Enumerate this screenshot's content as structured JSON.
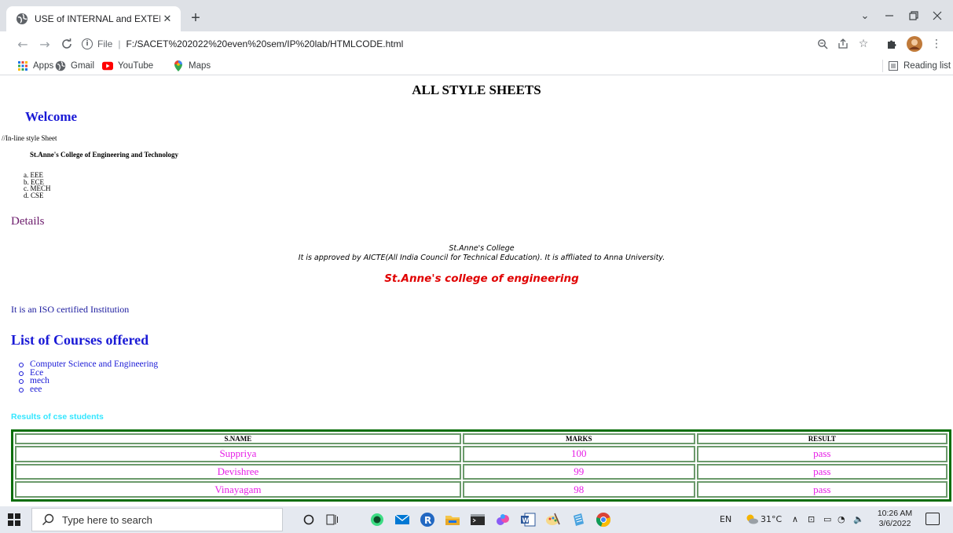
{
  "browser": {
    "tab_title": "USE of INTERNAL and EXTERNAL",
    "tab_close": "✕",
    "new_tab": "+",
    "omnibox_file_label": "File",
    "omnibox_separator": "|",
    "url": "F:/SACET%202022%20even%20sem/IP%20lab/HTMLCODE.html",
    "bookmarks": [
      {
        "label": "Apps",
        "icon": "apps-grid-icon"
      },
      {
        "label": "Gmail",
        "icon": "globe-icon"
      },
      {
        "label": "YouTube",
        "icon": "youtube-icon"
      },
      {
        "label": "Maps",
        "icon": "maps-pin-icon"
      }
    ],
    "reading_list": "Reading list"
  },
  "page": {
    "heading": "ALL STYLE SHEETS",
    "welcome": "Welcome",
    "inline_note": "//In-line style Sheet",
    "college_small": "St.Anne's College of Engineering and Technology",
    "ordered_list": [
      "a. EEE",
      "b. ECE",
      "c. MECH",
      "d. CSE"
    ],
    "details": "Details",
    "address_line1": "St.Anne's College",
    "address_line2": "It is approved by AICTE(All India Council for Technical Education). It is affliated to Anna University.",
    "college_red": "St.Anne's college of engineering",
    "iso_line": "It is an ISO certified Institution",
    "courses_title": "List of Courses offered",
    "courses": [
      "Computer Science and Engineering",
      "Ece",
      "mech",
      "eee"
    ],
    "results_title": "Results of cse students",
    "table": {
      "headers": [
        "S.NAME",
        "MARKS",
        "RESULT"
      ],
      "rows": [
        [
          "Suppriya",
          "100",
          "pass"
        ],
        [
          "Devishree",
          "99",
          "pass"
        ],
        [
          "Vinayagam",
          "98",
          "pass"
        ]
      ]
    }
  },
  "taskbar": {
    "search_placeholder": "Type here to search",
    "language": "EN",
    "weather": "31°C",
    "time": "10:26 AM",
    "date": "3/6/2022"
  },
  "colors": {
    "welcome_blue": "#1a1ad6",
    "details_purple": "#6b1a6b",
    "college_red": "#e00000",
    "results_cyan": "#33e6ff",
    "table_text_magenta": "#e61ee6",
    "table_border_green": "#0a6e0a"
  }
}
